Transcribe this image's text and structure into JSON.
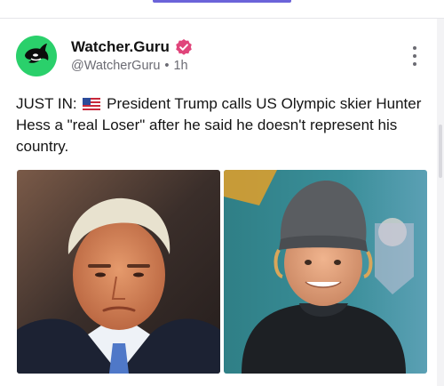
{
  "post": {
    "author_name": "Watcher.Guru",
    "handle": "@WatcherGuru",
    "separator": "•",
    "time": "1h",
    "text_prefix": "JUST IN:",
    "text_body": "President Trump calls US Olympic skier Hunter Hess a \"real Loser\" after he said he doesn't represent his country.",
    "flag_icon": "us-flag-icon"
  },
  "colors": {
    "avatar_bg": "#2ad06b",
    "verified_badge": "#e0457b",
    "tab_indicator": "#6b63d9"
  },
  "icons": {
    "avatar": "orca-logo-icon",
    "verified": "verified-badge-icon",
    "more": "more-vertical-icon"
  }
}
